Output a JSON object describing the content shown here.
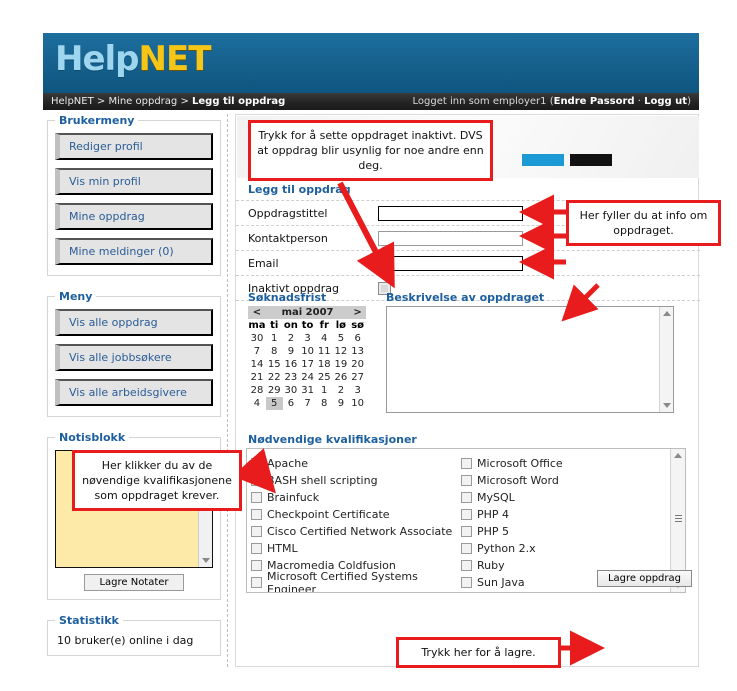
{
  "header": {
    "logo_help": "Help",
    "logo_net": "NET",
    "breadcrumb_prefix": "HelpNET > Mine oppdrag > ",
    "breadcrumb_current": "Legg til oppdrag",
    "login_text": "Logget inn som employer1 (",
    "login_change_password": "Endre Passord",
    "login_separator": " · ",
    "login_logout": "Logg ut",
    "login_text_end": ")"
  },
  "sidebar": {
    "user_menu": {
      "legend": "Brukermeny",
      "items": [
        {
          "label": "Rediger profil"
        },
        {
          "label": "Vis min profil"
        },
        {
          "label": "Mine oppdrag"
        },
        {
          "label": "Mine meldinger (0)"
        }
      ]
    },
    "main_menu": {
      "legend": "Meny",
      "items": [
        {
          "label": "Vis alle oppdrag"
        },
        {
          "label": "Vis alle jobbsøkere"
        },
        {
          "label": "Vis alle arbeidsgivere"
        }
      ]
    },
    "notepad": {
      "legend": "Notisblokk",
      "value": "",
      "save_label": "Lagre Notater"
    },
    "statistics": {
      "legend": "Statistikk",
      "line": "10 bruker(e) online i dag"
    }
  },
  "main": {
    "form_title": "Legg til oppdrag",
    "fields": [
      {
        "label": "Oppdragstittel",
        "value": "",
        "type": "text"
      },
      {
        "label": "Kontaktperson",
        "value": "",
        "type": "text"
      },
      {
        "label": "Email",
        "value": "",
        "type": "text"
      },
      {
        "label": "Inaktivt oppdrag",
        "value": "",
        "type": "checkbox"
      }
    ],
    "calendar": {
      "title": "Søknadsfrist",
      "prev": "<",
      "month_label": "mai 2007",
      "next": ">",
      "weekdays": [
        "ma",
        "ti",
        "on",
        "to",
        "fr",
        "lø",
        "sø"
      ],
      "weeks": [
        [
          "30",
          "1",
          "2",
          "3",
          "4",
          "5",
          "6"
        ],
        [
          "7",
          "8",
          "9",
          "10",
          "11",
          "12",
          "13"
        ],
        [
          "14",
          "15",
          "16",
          "17",
          "18",
          "19",
          "20"
        ],
        [
          "21",
          "22",
          "23",
          "24",
          "25",
          "26",
          "27"
        ],
        [
          "28",
          "29",
          "30",
          "31",
          "1",
          "2",
          "3"
        ],
        [
          "4",
          "5",
          "6",
          "7",
          "8",
          "9",
          "10"
        ]
      ],
      "selected": {
        "row": 5,
        "col": 1,
        "value": "5"
      }
    },
    "description": {
      "title": "Beskrivelse av oppdraget",
      "value": ""
    },
    "qualifications": {
      "title": "Nødvendige kvalifikasjoner",
      "left_column": [
        {
          "label": "Apache",
          "checked": false
        },
        {
          "label": "BASH shell scripting",
          "checked": false
        },
        {
          "label": "Brainfuck",
          "checked": false
        },
        {
          "label": "Checkpoint Certificate",
          "checked": false
        },
        {
          "label": "Cisco Certified Network Associate",
          "checked": false
        },
        {
          "label": "HTML",
          "checked": false
        },
        {
          "label": "Macromedia Coldfusion",
          "checked": false
        },
        {
          "label": "Microsoft Certified Systems Engineer",
          "checked": false
        }
      ],
      "right_column": [
        {
          "label": "Microsoft Office",
          "checked": false
        },
        {
          "label": "Microsoft Word",
          "checked": false
        },
        {
          "label": "MySQL",
          "checked": false
        },
        {
          "label": "PHP 4",
          "checked": false
        },
        {
          "label": "PHP 5",
          "checked": false
        },
        {
          "label": "Python 2.x",
          "checked": false
        },
        {
          "label": "Ruby",
          "checked": false
        },
        {
          "label": "Sun Java",
          "checked": false
        }
      ]
    },
    "save_label": "Lagre oppdrag"
  },
  "annotations": {
    "inactive": "Trykk for å sette oppdraget inaktivt. DVS at oppdrag blir usynlig for noe andre enn deg.",
    "info": "Her fyller du at info om oppdraget.",
    "qualifications": "Her klikker du av de nøvendige kvalifikasjonene som oppdraget krever.",
    "save": "Trykk her for å lagre."
  },
  "colors": {
    "header_blue": "#17628f",
    "logo_cyan": "#9fd6ef",
    "logo_yellow": "#f5c518",
    "link_blue": "#2a5c96",
    "legend_blue": "#1d5f9e",
    "annotation_red": "#e81c1c",
    "banner_blue": "#1b9ad6",
    "notepad_yellow": "#fdeaa8"
  }
}
